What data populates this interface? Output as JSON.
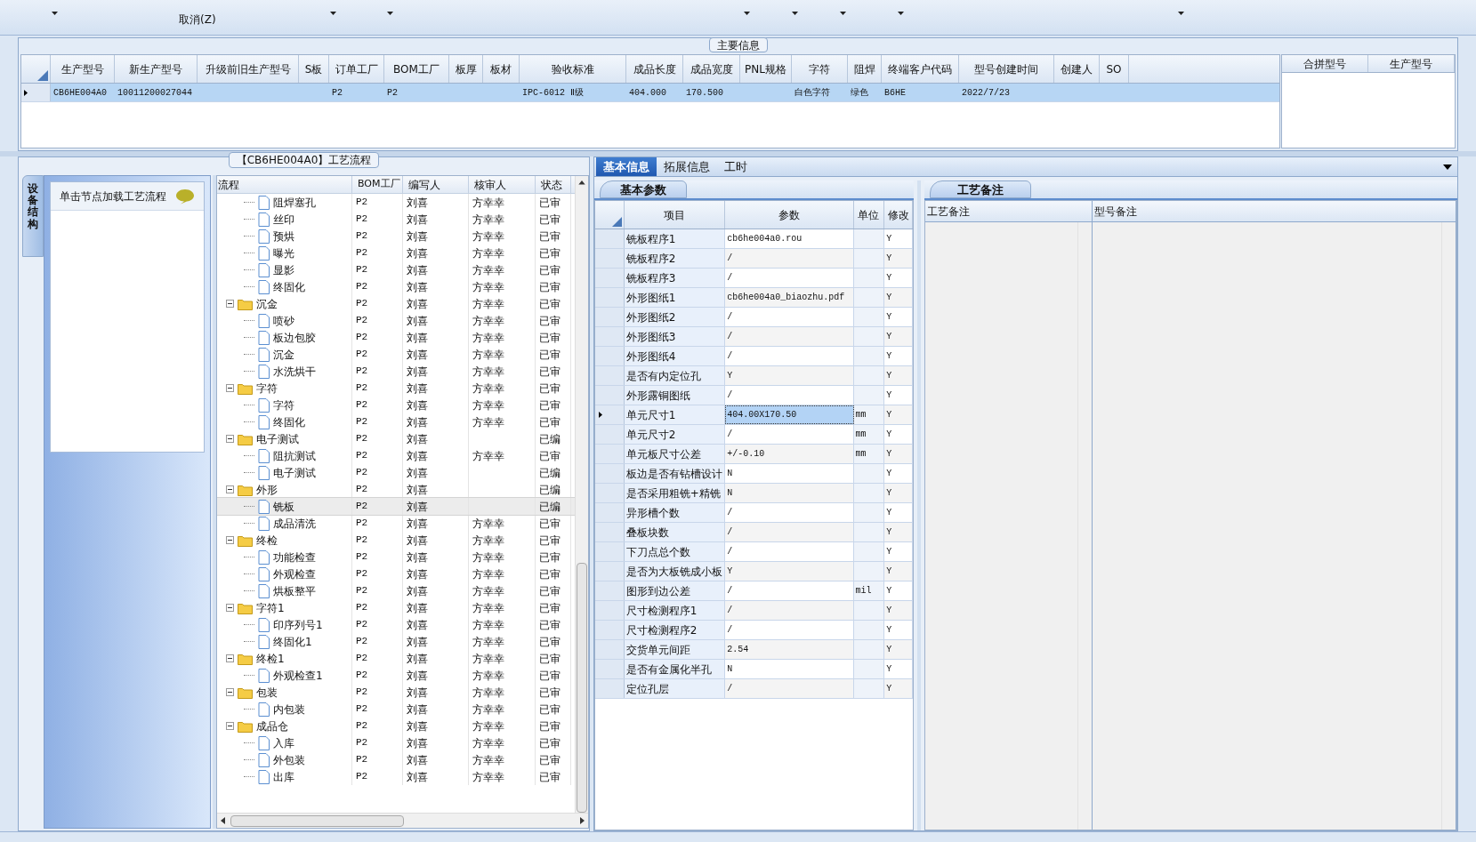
{
  "toolbar": {
    "cancel_label": "取消(Z)"
  },
  "main_info": {
    "title": "主要信息",
    "columns": [
      "生产型号",
      "新生产型号",
      "升级前旧生产型号",
      "S板",
      "订单工厂",
      "BOM工厂",
      "板厚",
      "板材",
      "验收标准",
      "成品长度",
      "成品宽度",
      "PNL规格",
      "字符",
      "阻焊",
      "终端客户代码",
      "型号创建时间",
      "创建人",
      "SO"
    ],
    "rows": [
      {
        "selected": true,
        "cells": [
          "CB6HE004A0",
          "10011200027044",
          null,
          null,
          "P2",
          "P2",
          null,
          null,
          "IPC-6012 Ⅱ级",
          "404.000",
          "170.500",
          null,
          "白色字符",
          "绿色",
          "B6HE",
          "2022/7/23",
          null,
          null
        ]
      }
    ],
    "side_columns": [
      "合拼型号",
      "生产型号"
    ]
  },
  "process_panel": {
    "title": "【CB6HE004A0】工艺流程",
    "side_tab": "设备结构",
    "hint": "单击节点加载工艺流程",
    "tree": {
      "columns": [
        "流程",
        "BOM工厂",
        "编写人",
        "核审人",
        "状态"
      ],
      "continued_rows": [
        {
          "kind": "file",
          "name": "阻焊塞孔",
          "bom": "P2",
          "author": "刘喜",
          "reviewer": "方幸幸",
          "status": "已审",
          "selected": false
        },
        {
          "kind": "file",
          "name": "丝印",
          "bom": "P2",
          "author": "刘喜",
          "reviewer": "方幸幸",
          "status": "已审",
          "selected": false
        },
        {
          "kind": "file",
          "name": "预烘",
          "bom": "P2",
          "author": "刘喜",
          "reviewer": "方幸幸",
          "status": "已审",
          "selected": false
        },
        {
          "kind": "file",
          "name": "曝光",
          "bom": "P2",
          "author": "刘喜",
          "reviewer": "方幸幸",
          "status": "已审",
          "selected": false
        },
        {
          "kind": "file",
          "name": "显影",
          "bom": "P2",
          "author": "刘喜",
          "reviewer": "方幸幸",
          "status": "已审",
          "selected": false
        },
        {
          "kind": "file",
          "name": "终固化",
          "bom": "P2",
          "author": "刘喜",
          "reviewer": "方幸幸",
          "status": "已审",
          "selected": false
        }
      ],
      "nodes": [
        {
          "kind": "folder",
          "expanded": true,
          "name": "沉金",
          "bom": "P2",
          "author": "刘喜",
          "reviewer": "方幸幸",
          "status": "已审",
          "selected": false,
          "children": [
            {
              "kind": "file",
              "name": "喷砂",
              "bom": "P2",
              "author": "刘喜",
              "reviewer": "方幸幸",
              "status": "已审",
              "selected": false
            },
            {
              "kind": "file",
              "name": "板边包胶",
              "bom": "P2",
              "author": "刘喜",
              "reviewer": "方幸幸",
              "status": "已审",
              "selected": false
            },
            {
              "kind": "file",
              "name": "沉金",
              "bom": "P2",
              "author": "刘喜",
              "reviewer": "方幸幸",
              "status": "已审",
              "selected": false
            },
            {
              "kind": "file",
              "name": "水洗烘干",
              "bom": "P2",
              "author": "刘喜",
              "reviewer": "方幸幸",
              "status": "已审",
              "selected": false
            }
          ]
        },
        {
          "kind": "folder",
          "expanded": true,
          "name": "字符",
          "bom": "P2",
          "author": "刘喜",
          "reviewer": "方幸幸",
          "status": "已审",
          "selected": false,
          "children": [
            {
              "kind": "file",
              "name": "字符",
              "bom": "P2",
              "author": "刘喜",
              "reviewer": "方幸幸",
              "status": "已审",
              "selected": false
            },
            {
              "kind": "file",
              "name": "终固化",
              "bom": "P2",
              "author": "刘喜",
              "reviewer": "方幸幸",
              "status": "已审",
              "selected": false
            }
          ]
        },
        {
          "kind": "folder",
          "expanded": true,
          "name": "电子测试",
          "bom": "P2",
          "author": "刘喜",
          "status": "已编",
          "selected": false,
          "children": [
            {
              "kind": "file",
              "name": "阻抗测试",
              "bom": "P2",
              "author": "刘喜",
              "reviewer": "方幸幸",
              "status": "已审",
              "selected": false
            },
            {
              "kind": "file",
              "name": "电子测试",
              "bom": "P2",
              "author": "刘喜",
              "status": "已编",
              "selected": false
            }
          ]
        },
        {
          "kind": "folder",
          "expanded": true,
          "name": "外形",
          "bom": "P2",
          "author": "刘喜",
          "status": "已编",
          "selected": false,
          "children": [
            {
              "kind": "file",
              "name": "铣板",
              "bom": "P2",
              "author": "刘喜",
              "status": "已编",
              "selected": true
            },
            {
              "kind": "file",
              "name": "成品清洗",
              "bom": "P2",
              "author": "刘喜",
              "reviewer": "方幸幸",
              "status": "已审",
              "selected": false
            }
          ]
        },
        {
          "kind": "folder",
          "expanded": true,
          "name": "终检",
          "bom": "P2",
          "author": "刘喜",
          "reviewer": "方幸幸",
          "status": "已审",
          "selected": false,
          "children": [
            {
              "kind": "file",
              "name": "功能检查",
              "bom": "P2",
              "author": "刘喜",
              "reviewer": "方幸幸",
              "status": "已审",
              "selected": false
            },
            {
              "kind": "file",
              "name": "外观检查",
              "bom": "P2",
              "author": "刘喜",
              "reviewer": "方幸幸",
              "status": "已审",
              "selected": false
            },
            {
              "kind": "file",
              "name": "烘板整平",
              "bom": "P2",
              "author": "刘喜",
              "reviewer": "方幸幸",
              "status": "已审",
              "selected": false
            }
          ]
        },
        {
          "kind": "folder",
          "expanded": true,
          "name": "字符1",
          "bom": "P2",
          "author": "刘喜",
          "reviewer": "方幸幸",
          "status": "已审",
          "selected": false,
          "children": [
            {
              "kind": "file",
              "name": "印序列号1",
              "bom": "P2",
              "author": "刘喜",
              "reviewer": "方幸幸",
              "status": "已审",
              "selected": false
            },
            {
              "kind": "file",
              "name": "终固化1",
              "bom": "P2",
              "author": "刘喜",
              "reviewer": "方幸幸",
              "status": "已审",
              "selected": false
            }
          ]
        },
        {
          "kind": "folder",
          "expanded": true,
          "name": "终检1",
          "bom": "P2",
          "author": "刘喜",
          "reviewer": "方幸幸",
          "status": "已审",
          "selected": false,
          "children": [
            {
              "kind": "file",
              "name": "外观检查1",
              "bom": "P2",
              "author": "刘喜",
              "reviewer": "方幸幸",
              "status": "已审",
              "selected": false
            }
          ]
        },
        {
          "kind": "folder",
          "expanded": true,
          "name": "包装",
          "bom": "P2",
          "author": "刘喜",
          "reviewer": "方幸幸",
          "status": "已审",
          "selected": false,
          "children": [
            {
              "kind": "file",
              "name": "内包装",
              "bom": "P2",
              "author": "刘喜",
              "reviewer": "方幸幸",
              "status": "已审",
              "selected": false
            }
          ]
        },
        {
          "kind": "folder",
          "expanded": true,
          "name": "成品仓",
          "bom": "P2",
          "author": "刘喜",
          "reviewer": "方幸幸",
          "status": "已审",
          "selected": false,
          "children": [
            {
              "kind": "file",
              "name": "入库",
              "bom": "P2",
              "author": "刘喜",
              "reviewer": "方幸幸",
              "status": "已审",
              "selected": false
            },
            {
              "kind": "file",
              "name": "外包装",
              "bom": "P2",
              "author": "刘喜",
              "reviewer": "方幸幸",
              "status": "已审",
              "selected": false
            },
            {
              "kind": "file",
              "name": "出库",
              "bom": "P2",
              "author": "刘喜",
              "reviewer": "方幸幸",
              "status": "已审",
              "selected": false
            }
          ]
        }
      ]
    }
  },
  "detail_tabs": [
    {
      "label": "基本信息",
      "selected": true
    },
    {
      "label": "拓展信息",
      "selected": false
    },
    {
      "label": "工时",
      "selected": false
    }
  ],
  "params": {
    "tab": "基本参数",
    "columns": [
      "项目",
      "参数",
      "单位",
      "修改"
    ],
    "rows": [
      {
        "item": "铣板程序1",
        "value": "cb6he004a0.rou",
        "modified": "Y",
        "selected": false
      },
      {
        "item": "铣板程序2",
        "value": "/",
        "modified": "Y",
        "selected": false
      },
      {
        "item": "铣板程序3",
        "value": "/",
        "modified": "Y",
        "selected": false
      },
      {
        "item": "外形图纸1",
        "value": "cb6he004a0_biaozhu.pdf",
        "modified": "Y",
        "selected": false
      },
      {
        "item": "外形图纸2",
        "value": "/",
        "modified": "Y",
        "selected": false
      },
      {
        "item": "外形图纸3",
        "value": "/",
        "modified": "Y",
        "selected": false
      },
      {
        "item": "外形图纸4",
        "value": "/",
        "modified": "Y",
        "selected": false
      },
      {
        "item": "是否有内定位孔",
        "value": "Y",
        "modified": "Y",
        "selected": false
      },
      {
        "item": "外形露铜图纸",
        "value": "/",
        "modified": "Y",
        "selected": false
      },
      {
        "item": "单元尺寸1",
        "value": "404.00X170.50",
        "unit": "mm",
        "modified": "Y",
        "selected": true
      },
      {
        "item": "单元尺寸2",
        "value": "/",
        "unit": "mm",
        "modified": "Y",
        "selected": false
      },
      {
        "item": "单元板尺寸公差",
        "value": "+/-0.10",
        "unit": "mm",
        "modified": "Y",
        "selected": false
      },
      {
        "item": "板边是否有钻槽设计",
        "value": "N",
        "modified": "Y",
        "selected": false
      },
      {
        "item": "是否采用粗铣+精铣",
        "value": "N",
        "modified": "Y",
        "selected": false
      },
      {
        "item": "异形槽个数",
        "value": "/",
        "modified": "Y",
        "selected": false
      },
      {
        "item": "叠板块数",
        "value": "/",
        "modified": "Y",
        "selected": false
      },
      {
        "item": "下刀点总个数",
        "value": "/",
        "modified": "Y",
        "selected": false
      },
      {
        "item": "是否为大板铣成小板",
        "value": "Y",
        "modified": "Y",
        "selected": false
      },
      {
        "item": "图形到边公差",
        "value": "/",
        "unit": "mil",
        "modified": "Y",
        "selected": false
      },
      {
        "item": "尺寸检测程序1",
        "value": "/",
        "modified": "Y",
        "selected": false
      },
      {
        "item": "尺寸检测程序2",
        "value": "/",
        "modified": "Y",
        "selected": false
      },
      {
        "item": "交货单元间距",
        "value": "2.54",
        "modified": "Y",
        "selected": false
      },
      {
        "item": "是否有金属化半孔",
        "value": "N",
        "modified": "Y",
        "selected": false
      },
      {
        "item": "定位孔层",
        "value": "/",
        "modified": "Y",
        "selected": false
      }
    ]
  },
  "notes": {
    "tab": "工艺备注",
    "columns": [
      "工艺备注",
      "型号备注"
    ]
  }
}
